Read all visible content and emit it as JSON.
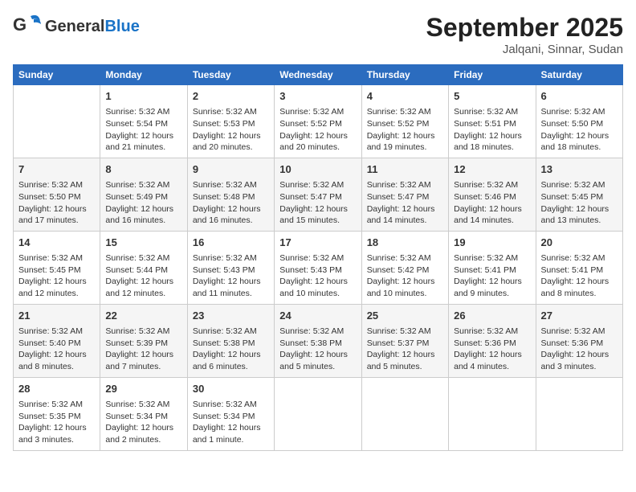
{
  "header": {
    "logo_general": "General",
    "logo_blue": "Blue",
    "month": "September 2025",
    "location": "Jalqani, Sinnar, Sudan"
  },
  "days_of_week": [
    "Sunday",
    "Monday",
    "Tuesday",
    "Wednesday",
    "Thursday",
    "Friday",
    "Saturday"
  ],
  "weeks": [
    [
      {
        "day": "",
        "info": ""
      },
      {
        "day": "1",
        "info": "Sunrise: 5:32 AM\nSunset: 5:54 PM\nDaylight: 12 hours\nand 21 minutes."
      },
      {
        "day": "2",
        "info": "Sunrise: 5:32 AM\nSunset: 5:53 PM\nDaylight: 12 hours\nand 20 minutes."
      },
      {
        "day": "3",
        "info": "Sunrise: 5:32 AM\nSunset: 5:52 PM\nDaylight: 12 hours\nand 20 minutes."
      },
      {
        "day": "4",
        "info": "Sunrise: 5:32 AM\nSunset: 5:52 PM\nDaylight: 12 hours\nand 19 minutes."
      },
      {
        "day": "5",
        "info": "Sunrise: 5:32 AM\nSunset: 5:51 PM\nDaylight: 12 hours\nand 18 minutes."
      },
      {
        "day": "6",
        "info": "Sunrise: 5:32 AM\nSunset: 5:50 PM\nDaylight: 12 hours\nand 18 minutes."
      }
    ],
    [
      {
        "day": "7",
        "info": "Sunrise: 5:32 AM\nSunset: 5:50 PM\nDaylight: 12 hours\nand 17 minutes."
      },
      {
        "day": "8",
        "info": "Sunrise: 5:32 AM\nSunset: 5:49 PM\nDaylight: 12 hours\nand 16 minutes."
      },
      {
        "day": "9",
        "info": "Sunrise: 5:32 AM\nSunset: 5:48 PM\nDaylight: 12 hours\nand 16 minutes."
      },
      {
        "day": "10",
        "info": "Sunrise: 5:32 AM\nSunset: 5:47 PM\nDaylight: 12 hours\nand 15 minutes."
      },
      {
        "day": "11",
        "info": "Sunrise: 5:32 AM\nSunset: 5:47 PM\nDaylight: 12 hours\nand 14 minutes."
      },
      {
        "day": "12",
        "info": "Sunrise: 5:32 AM\nSunset: 5:46 PM\nDaylight: 12 hours\nand 14 minutes."
      },
      {
        "day": "13",
        "info": "Sunrise: 5:32 AM\nSunset: 5:45 PM\nDaylight: 12 hours\nand 13 minutes."
      }
    ],
    [
      {
        "day": "14",
        "info": "Sunrise: 5:32 AM\nSunset: 5:45 PM\nDaylight: 12 hours\nand 12 minutes."
      },
      {
        "day": "15",
        "info": "Sunrise: 5:32 AM\nSunset: 5:44 PM\nDaylight: 12 hours\nand 12 minutes."
      },
      {
        "day": "16",
        "info": "Sunrise: 5:32 AM\nSunset: 5:43 PM\nDaylight: 12 hours\nand 11 minutes."
      },
      {
        "day": "17",
        "info": "Sunrise: 5:32 AM\nSunset: 5:43 PM\nDaylight: 12 hours\nand 10 minutes."
      },
      {
        "day": "18",
        "info": "Sunrise: 5:32 AM\nSunset: 5:42 PM\nDaylight: 12 hours\nand 10 minutes."
      },
      {
        "day": "19",
        "info": "Sunrise: 5:32 AM\nSunset: 5:41 PM\nDaylight: 12 hours\nand 9 minutes."
      },
      {
        "day": "20",
        "info": "Sunrise: 5:32 AM\nSunset: 5:41 PM\nDaylight: 12 hours\nand 8 minutes."
      }
    ],
    [
      {
        "day": "21",
        "info": "Sunrise: 5:32 AM\nSunset: 5:40 PM\nDaylight: 12 hours\nand 8 minutes."
      },
      {
        "day": "22",
        "info": "Sunrise: 5:32 AM\nSunset: 5:39 PM\nDaylight: 12 hours\nand 7 minutes."
      },
      {
        "day": "23",
        "info": "Sunrise: 5:32 AM\nSunset: 5:38 PM\nDaylight: 12 hours\nand 6 minutes."
      },
      {
        "day": "24",
        "info": "Sunrise: 5:32 AM\nSunset: 5:38 PM\nDaylight: 12 hours\nand 5 minutes."
      },
      {
        "day": "25",
        "info": "Sunrise: 5:32 AM\nSunset: 5:37 PM\nDaylight: 12 hours\nand 5 minutes."
      },
      {
        "day": "26",
        "info": "Sunrise: 5:32 AM\nSunset: 5:36 PM\nDaylight: 12 hours\nand 4 minutes."
      },
      {
        "day": "27",
        "info": "Sunrise: 5:32 AM\nSunset: 5:36 PM\nDaylight: 12 hours\nand 3 minutes."
      }
    ],
    [
      {
        "day": "28",
        "info": "Sunrise: 5:32 AM\nSunset: 5:35 PM\nDaylight: 12 hours\nand 3 minutes."
      },
      {
        "day": "29",
        "info": "Sunrise: 5:32 AM\nSunset: 5:34 PM\nDaylight: 12 hours\nand 2 minutes."
      },
      {
        "day": "30",
        "info": "Sunrise: 5:32 AM\nSunset: 5:34 PM\nDaylight: 12 hours\nand 1 minute."
      },
      {
        "day": "",
        "info": ""
      },
      {
        "day": "",
        "info": ""
      },
      {
        "day": "",
        "info": ""
      },
      {
        "day": "",
        "info": ""
      }
    ]
  ]
}
